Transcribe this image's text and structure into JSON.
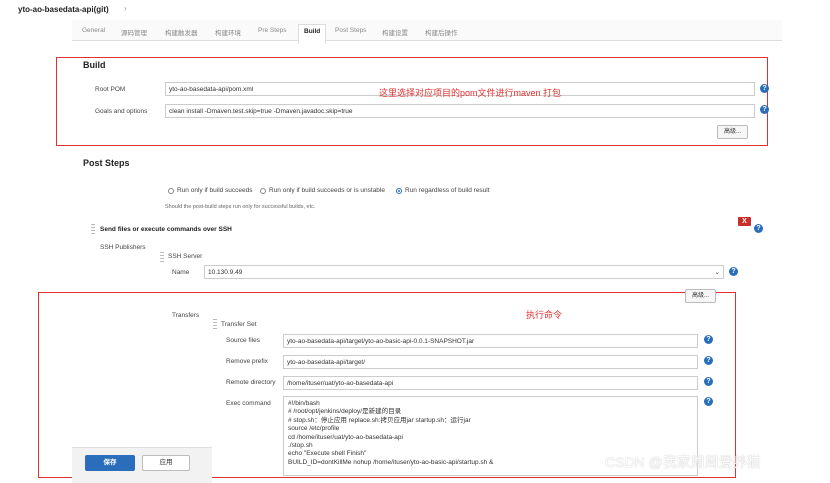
{
  "breadcrumb": {
    "project": "yto-ao-basedata-api(git)"
  },
  "tabs": [
    "General",
    "源码管理",
    "构建触发器",
    "构建环境",
    "Pre Steps",
    "Build",
    "Post Steps",
    "构建设置",
    "构建后操作"
  ],
  "build": {
    "title": "Build",
    "root_pom_label": "Root POM",
    "root_pom_value": "yto-ao-basedata-api/pom.xml",
    "goals_label": "Goals and options",
    "goals_value": "clean install -Dmaven.test.skip=true -Dmaven.javadoc.skip=true",
    "advanced_label": "高级...",
    "annotation": "这里选择对应项目的pom文件进行maven 打包"
  },
  "post_steps": {
    "title": "Post Steps",
    "radio_options": [
      "Run only if build succeeds",
      "Run only if build succeeds or is unstable",
      "Run regardless of build result"
    ],
    "selected_radio": 2,
    "hint": "Should the post-build steps run only for successful builds, etc.",
    "step_title": "Send files or execute commands over SSH",
    "delete_label": "X",
    "ssh_publishers_label": "SSH Publishers",
    "ssh_server_label": "SSH Server",
    "name_label": "Name",
    "name_value": "10.130.9.49",
    "advanced_label": "高级...",
    "transfers_label": "Transfers",
    "transfer_set_label": "Transfer Set",
    "annotation": "执行命令",
    "source_files_label": "Source files",
    "source_files_value": "yto-ao-basedata-api/target/yto-ao-basic-api-0.0.1-SNAPSHOT.jar",
    "remove_prefix_label": "Remove prefix",
    "remove_prefix_value": "yto-ao-basedata-api/target/",
    "remote_dir_label": "Remote directory",
    "remote_dir_value": "/home/ituser/uat/yto-ao-basedata-api",
    "exec_command_label": "Exec command",
    "exec_command_lines": [
      "#!/bin/bash",
      "# /root/opt/jenkins/deploy/是新建的目录",
      "# stop.sh：停止应用 replace.sh:拷贝应用jar startup.sh：运行jar",
      "source /etc/profile",
      "cd /home/ituser/uat/yto-ao-basedata-api",
      "./stop.sh",
      "echo \"Execute shell Finish\"",
      "BUILD_ID=dontKillMe nohup /home/ituser/yto-ao-basic-api/startup.sh &"
    ]
  },
  "footer": {
    "save_label": "保存",
    "apply_label": "应用"
  },
  "watermark": "CSDN @我家周周爱养猫",
  "help_glyph": "?",
  "colors": {
    "accent": "#2a6ebb",
    "annotation_red": "#e0312f",
    "delete_red": "#c9302c"
  }
}
